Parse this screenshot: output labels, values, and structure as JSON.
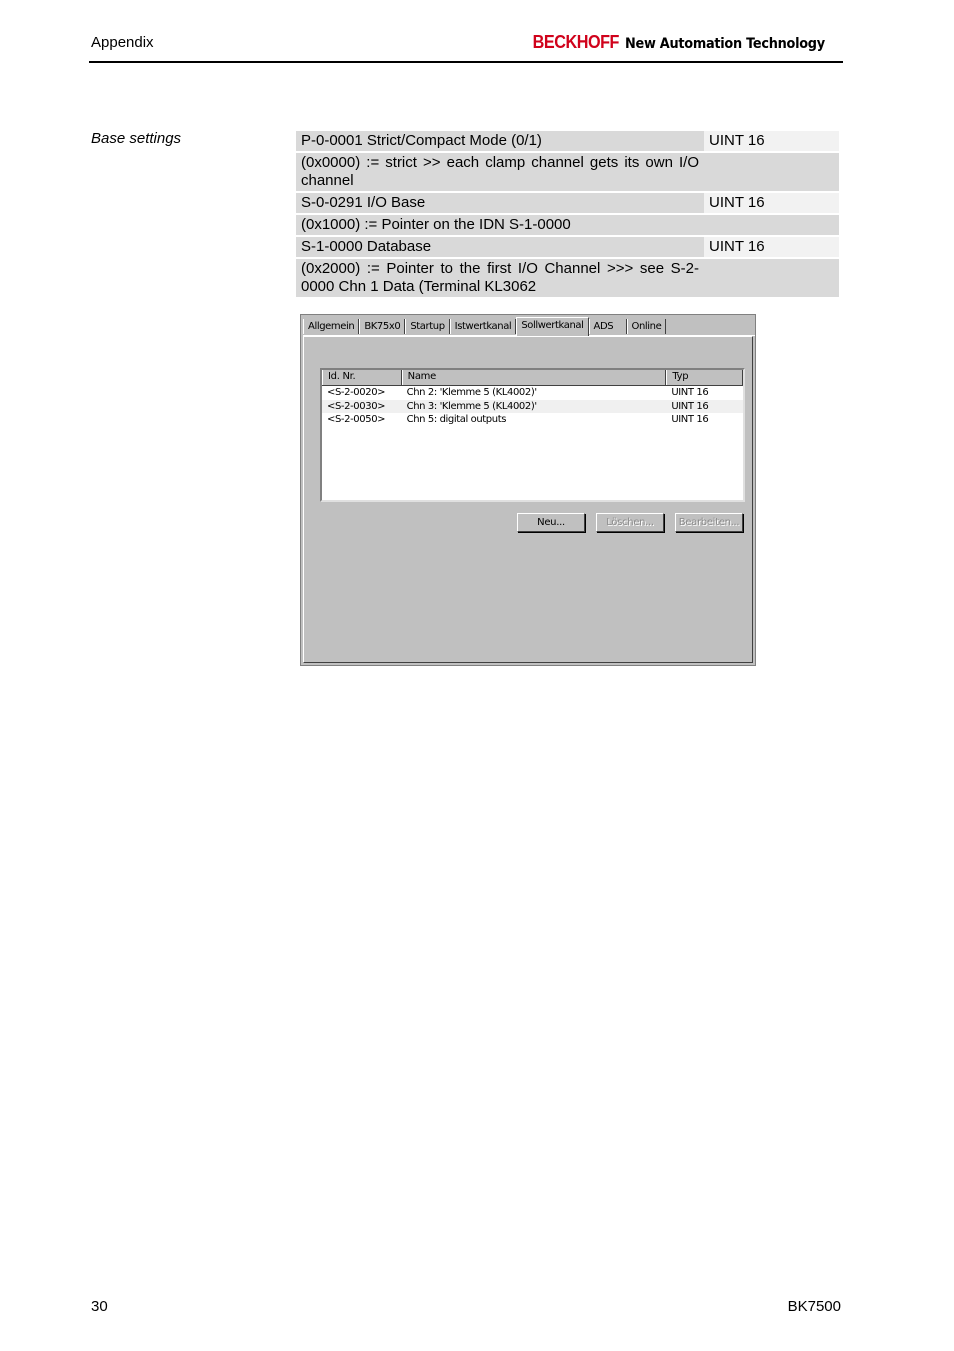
{
  "header": {
    "section": "Appendix",
    "brand": "BECKHOFF",
    "tagline": "New Automation Technology"
  },
  "section_label": "Base settings",
  "parameters": [
    {
      "text": "P-0-0001 Strict/Compact Mode (0/1)",
      "type": "UINT 16",
      "kind": "param"
    },
    {
      "text": "(0x0000)  := strict   >>  each clamp channel gets its own I/O channel",
      "type": "",
      "kind": "desc"
    },
    {
      "text": "S-0-0291 I/O Base",
      "type": "UINT 16",
      "kind": "param"
    },
    {
      "text": "(0x1000) := Pointer on the IDN S-1-0000",
      "type": "",
      "kind": "desc"
    },
    {
      "text": "S-1-0000 Database",
      "type": "UINT 16",
      "kind": "param"
    },
    {
      "text": "(0x2000) := Pointer to the first I/O Channel >>>  see S-2-0000 Chn 1 Data (Terminal KL3062",
      "type": "",
      "kind": "desc"
    }
  ],
  "dialog": {
    "tabs": [
      "Allgemein",
      "BK75x0",
      "Startup",
      "Istwertkanal",
      "Sollwertkanal",
      "ADS",
      "Online"
    ],
    "active_tab": "Sollwertkanal",
    "columns": {
      "id": "Id. Nr.",
      "name": "Name",
      "typ": "Typ"
    },
    "rows": [
      {
        "id": "<S-2-0020>",
        "name": "Chn 2: 'Klemme 5 (KL4002)'",
        "typ": "UINT 16"
      },
      {
        "id": "<S-2-0030>",
        "name": "Chn 3: 'Klemme 5 (KL4002)'",
        "typ": "UINT 16"
      },
      {
        "id": "<S-2-0050>",
        "name": "Chn 5: digital outputs",
        "typ": "UINT 16"
      }
    ],
    "buttons": {
      "new": "Neu...",
      "delete": "Löschen...",
      "edit": "Bearbeiten..."
    }
  },
  "footer": {
    "page_number": "30",
    "product": "BK7500"
  }
}
